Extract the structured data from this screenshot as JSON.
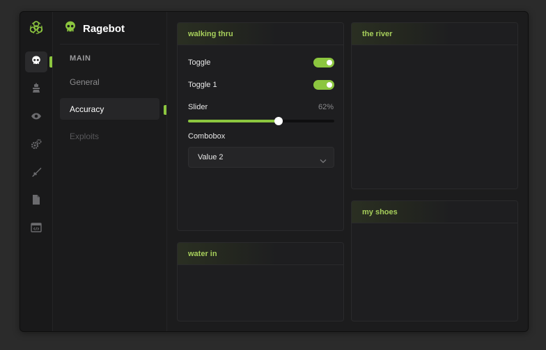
{
  "colors": {
    "accent": "#8cc63f",
    "header_text": "#a7cf5b"
  },
  "rail": {
    "icons": [
      "biohazard-icon",
      "skull-icon",
      "turret-icon",
      "eye-icon",
      "gears-icon",
      "rifle-icon",
      "file-icon",
      "code-window-icon"
    ],
    "active": "skull-icon"
  },
  "brand": {
    "title": "Ragebot",
    "icon": "skull-icon"
  },
  "subnav": {
    "section": "MAIN",
    "items": [
      {
        "label": "General",
        "state": "normal"
      },
      {
        "label": "Accuracy",
        "state": "active"
      },
      {
        "label": "Exploits",
        "state": "disabled"
      }
    ]
  },
  "panels": {
    "walking": {
      "title": "walking thru",
      "toggle": {
        "label": "Toggle",
        "on": true
      },
      "toggle1": {
        "label": "Toggle 1",
        "on": true
      },
      "slider": {
        "label": "Slider",
        "value_text": "62%",
        "value": 0.62
      },
      "combobox": {
        "label": "Combobox",
        "value": "Value 2"
      }
    },
    "river": {
      "title": "the river"
    },
    "shoes": {
      "title": "my shoes"
    },
    "water": {
      "title": "water in"
    }
  }
}
